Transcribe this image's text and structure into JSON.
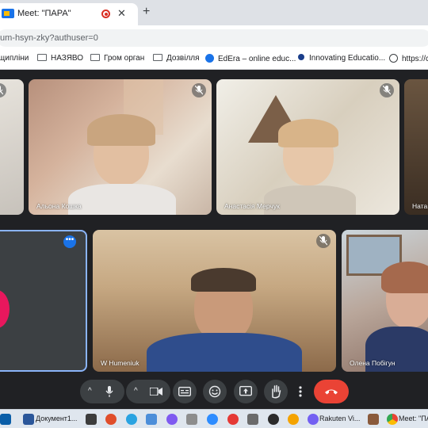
{
  "browser": {
    "tab_title": "Meet: \"ПАРА\"",
    "tab_close": "✕",
    "new_tab": "+",
    "url": "um-hsyn-zky?authuser=0"
  },
  "bookmarks": [
    {
      "label": "щипліни",
      "icon": "none"
    },
    {
      "label": "НАЗЯВО",
      "icon": "folder-icon"
    },
    {
      "label": "Гром орган",
      "icon": "folder-icon"
    },
    {
      "label": "Дозвілля",
      "icon": "folder-icon"
    },
    {
      "label": "EdEra – online educ...",
      "icon": "edera-icon"
    },
    {
      "label": "Innovating Educatio...",
      "icon": "dot-icon"
    },
    {
      "label": "https://c",
      "icon": "globe-icon"
    }
  ],
  "participants": [
    {
      "name": "Альона Кошка",
      "muted": true
    },
    {
      "name": "Анастасія Мерчук",
      "muted": true
    },
    {
      "name": "Ната",
      "muted": false
    },
    {
      "name": "W Humeniuk",
      "muted": true
    },
    {
      "name": "Олена Побігун",
      "muted": false
    }
  ],
  "self_tile": {
    "more_label": "•••"
  },
  "controls": {
    "chevron": "^"
  },
  "taskbar": {
    "items": [
      {
        "label": "Документ1...",
        "icon": "word-icon"
      },
      {
        "label": "Rakuten Vi...",
        "icon": "viber-icon"
      },
      {
        "label": "Meet: \"ПАРА\"",
        "icon": "chrome-icon"
      }
    ]
  },
  "colors": {
    "meet_background": "#202124",
    "control_button": "#3c4043",
    "end_call": "#ea4335",
    "accent_blue": "#1a73e8",
    "self_highlight": "#8ab4f8"
  }
}
